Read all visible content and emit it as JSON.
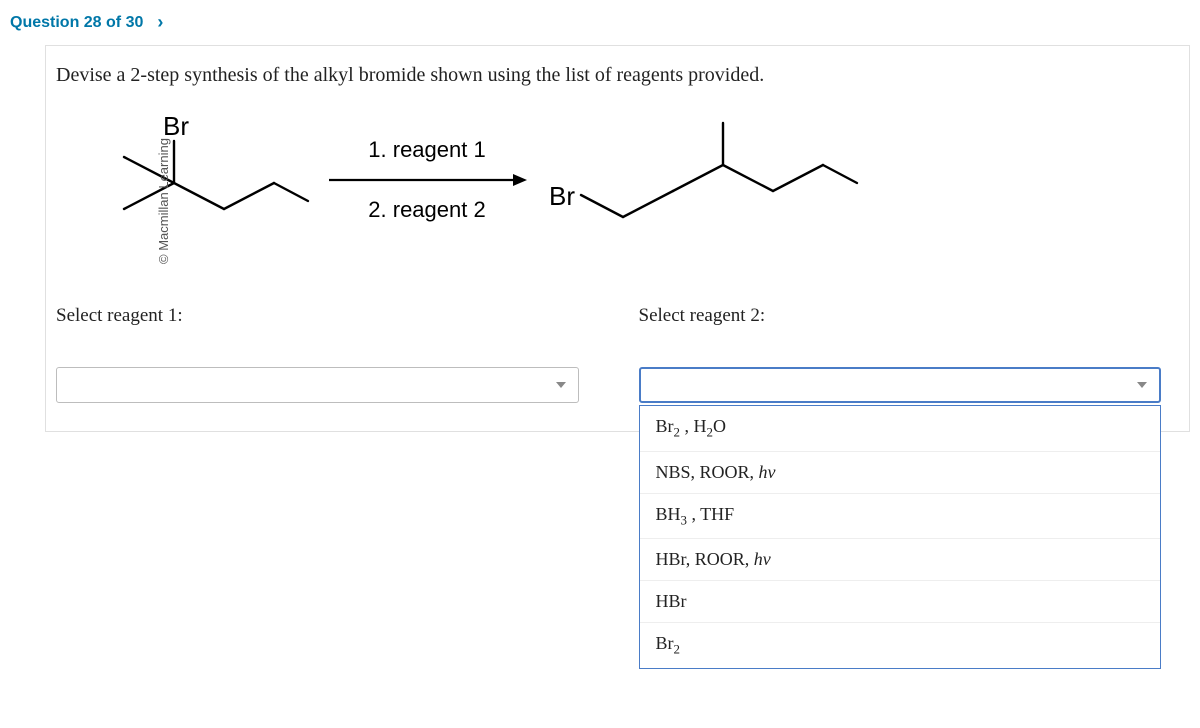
{
  "header": {
    "question_label": "Question 28 of 30"
  },
  "copyright": "© Macmillan Learning",
  "prompt": "Devise a 2-step synthesis of the alkyl bromide shown using the list of reagents provided.",
  "diagram": {
    "atom_br_start": "Br",
    "atom_br_end": "Br",
    "reagent1_label": "1. reagent 1",
    "reagent2_label": "2. reagent 2"
  },
  "selectors": {
    "r1_label": "Select reagent 1:",
    "r2_label": "Select reagent 2:"
  },
  "options": [
    {
      "html": "Br<sub>2</sub> , H<sub>2</sub>O"
    },
    {
      "html": "NBS, ROOR, <span class=\"italic\">hv</span>"
    },
    {
      "html": "BH<sub>3</sub> , THF"
    },
    {
      "html": "HBr, ROOR, <span class=\"italic\">hv</span>"
    },
    {
      "html": "HBr"
    },
    {
      "html": "Br<sub>2</sub>"
    }
  ]
}
